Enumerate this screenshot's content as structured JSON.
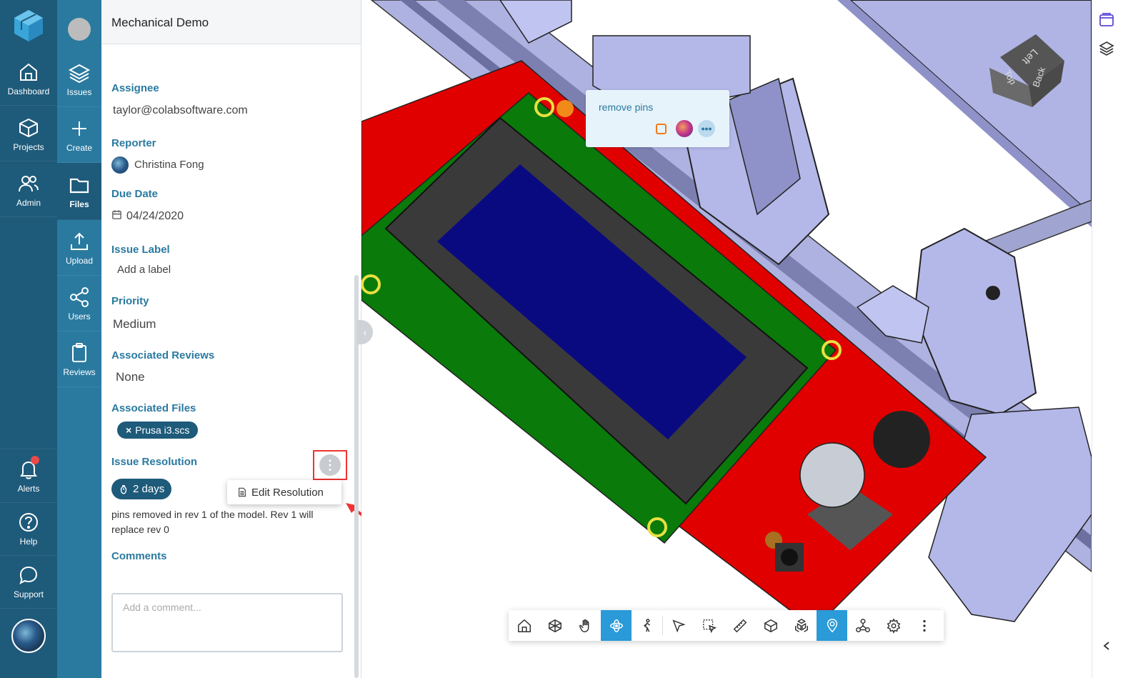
{
  "rail": {
    "items": [
      {
        "label": "Dashboard"
      },
      {
        "label": "Projects"
      },
      {
        "label": "Admin"
      },
      {
        "label": "Alerts"
      },
      {
        "label": "Help"
      },
      {
        "label": "Support"
      }
    ]
  },
  "subrail": {
    "items": [
      {
        "label": "Issues"
      },
      {
        "label": "Create"
      },
      {
        "label": "Files"
      },
      {
        "label": "Upload"
      },
      {
        "label": "Users"
      },
      {
        "label": "Reviews"
      }
    ]
  },
  "panel": {
    "title": "Mechanical Demo",
    "assignee_label": "Assignee",
    "assignee_value": "taylor@colabsoftware.com",
    "reporter_label": "Reporter",
    "reporter_value": "Christina Fong",
    "due_label": "Due Date",
    "due_value": "04/24/2020",
    "issue_label_label": "Issue Label",
    "issue_label_value": "Add a label",
    "priority_label": "Priority",
    "priority_value": "Medium",
    "reviews_label": "Associated Reviews",
    "reviews_value": "None",
    "files_label": "Associated Files",
    "file_chip": "Prusa i3.scs",
    "file_chip_remove": "×",
    "resolution_label": "Issue Resolution",
    "resolution_days": "2 days",
    "menu_edit": "Edit Resolution",
    "resolution_text": "pins removed in rev 1 of the model. Rev 1 will replace rev 0",
    "comments_label": "Comments",
    "comment_placeholder": "Add a comment..."
  },
  "viewer": {
    "tooltip_text": "remove pins",
    "cube_labels": [
      "Left",
      "Top",
      "Back"
    ],
    "toolbar": [
      {
        "icon": "home-icon"
      },
      {
        "icon": "orbit-box-icon"
      },
      {
        "icon": "hand-pan-icon"
      },
      {
        "icon": "orbit-icon",
        "active": true
      },
      {
        "icon": "walk-icon"
      },
      {
        "icon": "select-cursor-icon"
      },
      {
        "icon": "area-select-icon"
      },
      {
        "icon": "ruler-icon"
      },
      {
        "icon": "cube-icon"
      },
      {
        "icon": "explode-icon"
      },
      {
        "icon": "pin-icon",
        "active": true
      },
      {
        "icon": "tree-icon"
      },
      {
        "icon": "gear-icon"
      },
      {
        "icon": "more-icon"
      }
    ]
  },
  "colors": {
    "rail": "#1e5a7a",
    "subrail": "#2a7aa0",
    "accent": "#2a9ad8",
    "board_red": "#e00000",
    "board_green": "#0a7a0a",
    "lcd_blue": "#0a0a80",
    "part_lavender": "#b4b8e8"
  }
}
